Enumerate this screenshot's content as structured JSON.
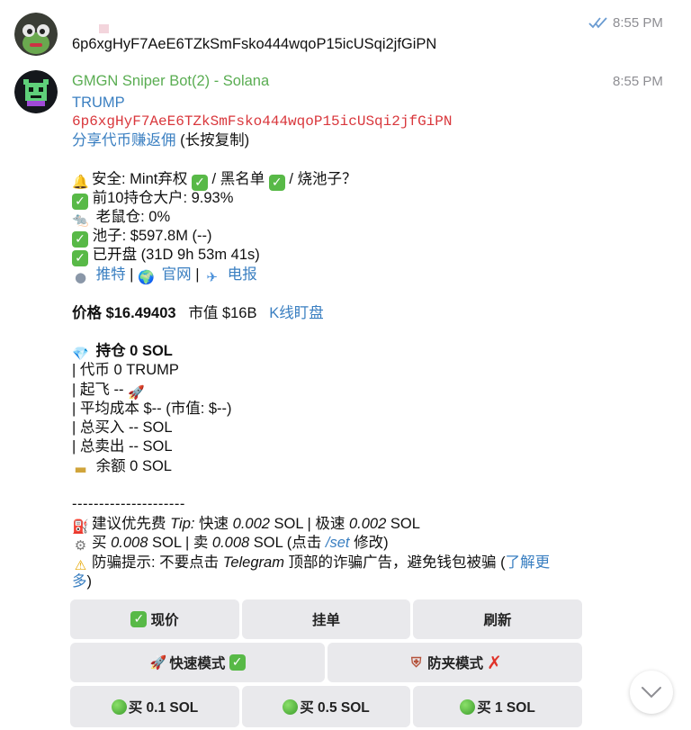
{
  "message1": {
    "time": "8:55 PM",
    "text": "6p6xgHyF7AeE6TZkSmFsko444wqoP15icUSqi2jfGiPN"
  },
  "message2": {
    "sender": "GMGN Sniper Bot(2) - Solana",
    "time": "8:55 PM",
    "token": "TRUMP",
    "address": "6p6xgHyF7AeE6TZkSmFsko444wqoP15icUSqi2jfGiPN",
    "share_link": "分享代币赚返佣",
    "share_hint": " (长按复制)",
    "security": "安全: Mint弃权 ",
    "blacklist": " / 黑名单 ",
    "burn": " / 烧池子？",
    "top10": "前10持仓大户: 9.93%",
    "rat": "老鼠仓: 0%",
    "pool": "池子: $597.8M (--)",
    "opened": "已开盘 (31D 9h 53m 41s)",
    "twitter": "推特",
    "site": "官网",
    "telegram": "电报",
    "sep": " | ",
    "price_label": "价格 $16.49403",
    "mcap": "市值 $16B",
    "kline": "K线盯盘",
    "holding": "持仓 0 SOL",
    "token_amt": "| 代币 0 TRUMP",
    "takeoff": "| 起飞 -- ",
    "avg_cost": "| 平均成本 $-- (市值: $--)",
    "total_buy": "| 总买入 -- SOL",
    "total_sell": "| 总卖出 -- SOL",
    "balance": "余额 0 SOL",
    "divider": "---------------------",
    "fee_prefix": "建议优先费 ",
    "fee_tip": "Tip:",
    "fee_fast": " 快速 ",
    "fee_fast_val": "0.002",
    "fee_sol1": " SOL | 极速 ",
    "fee_ultra_val": "0.002",
    "fee_sol2": " SOL",
    "buy_prefix": "买 ",
    "buy_val": "0.008",
    "sell_mid": " SOL | 卖 ",
    "sell_val": "0.008",
    "set_mid": " SOL (点击 ",
    "set_cmd": "/set",
    "set_end": " 修改)",
    "warn_prefix": "防骗提示: 不要点击 ",
    "warn_tg": "Telegram",
    "warn_mid": " 顶部的诈骗广告，避免钱包被骗 (",
    "warn_more1": "了解更",
    "warn_more2": "多",
    "warn_close": ")"
  },
  "buttons": {
    "limit_price": "现价",
    "limit_order": "挂单",
    "refresh": "刷新",
    "fast_mode": "快速模式",
    "anti_mev": "防夹模式",
    "buy1": "买 0.1 SOL",
    "buy2": "买 0.5 SOL",
    "buy3": "买 1 SOL"
  },
  "icons": {
    "read_receipt": "double-check-icon",
    "scroll_down": "chevron-down-icon"
  }
}
